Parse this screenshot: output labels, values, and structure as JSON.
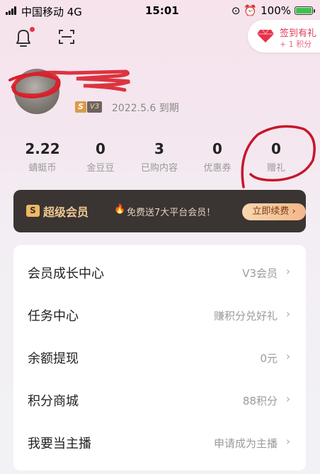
{
  "status_bar": {
    "carrier": "中国移动 4G",
    "time": "15:01",
    "battery": "100%"
  },
  "checkin": {
    "label": "签到有礼",
    "reward": "+ 1 积分"
  },
  "profile": {
    "level_badge": "S",
    "vip_level": "V3",
    "expiry": "2022.5.6 到期"
  },
  "stats": [
    {
      "value": "2.22",
      "label": "蜻蜓币"
    },
    {
      "value": "0",
      "label": "金豆豆"
    },
    {
      "value": "3",
      "label": "已购内容"
    },
    {
      "value": "0",
      "label": "优惠券"
    },
    {
      "value": "0",
      "label": "赠礼"
    }
  ],
  "vip_banner": {
    "icon_text": "S",
    "title": "超级会员",
    "promo": "免费送7大平台会员！",
    "button": "立即续费 ›"
  },
  "menu": [
    {
      "name": "会员成长中心",
      "value": "V3会员"
    },
    {
      "name": "任务中心",
      "value": "赚积分兑好礼"
    },
    {
      "name": "余额提现",
      "value": "0元"
    },
    {
      "name": "积分商城",
      "value": "88积分"
    },
    {
      "name": "我要当主播",
      "value": "申请成为主播"
    }
  ],
  "colors": {
    "accent": "#e23a5a",
    "banner_bg": "#3a3433",
    "banner_gold": "#f0c891"
  }
}
